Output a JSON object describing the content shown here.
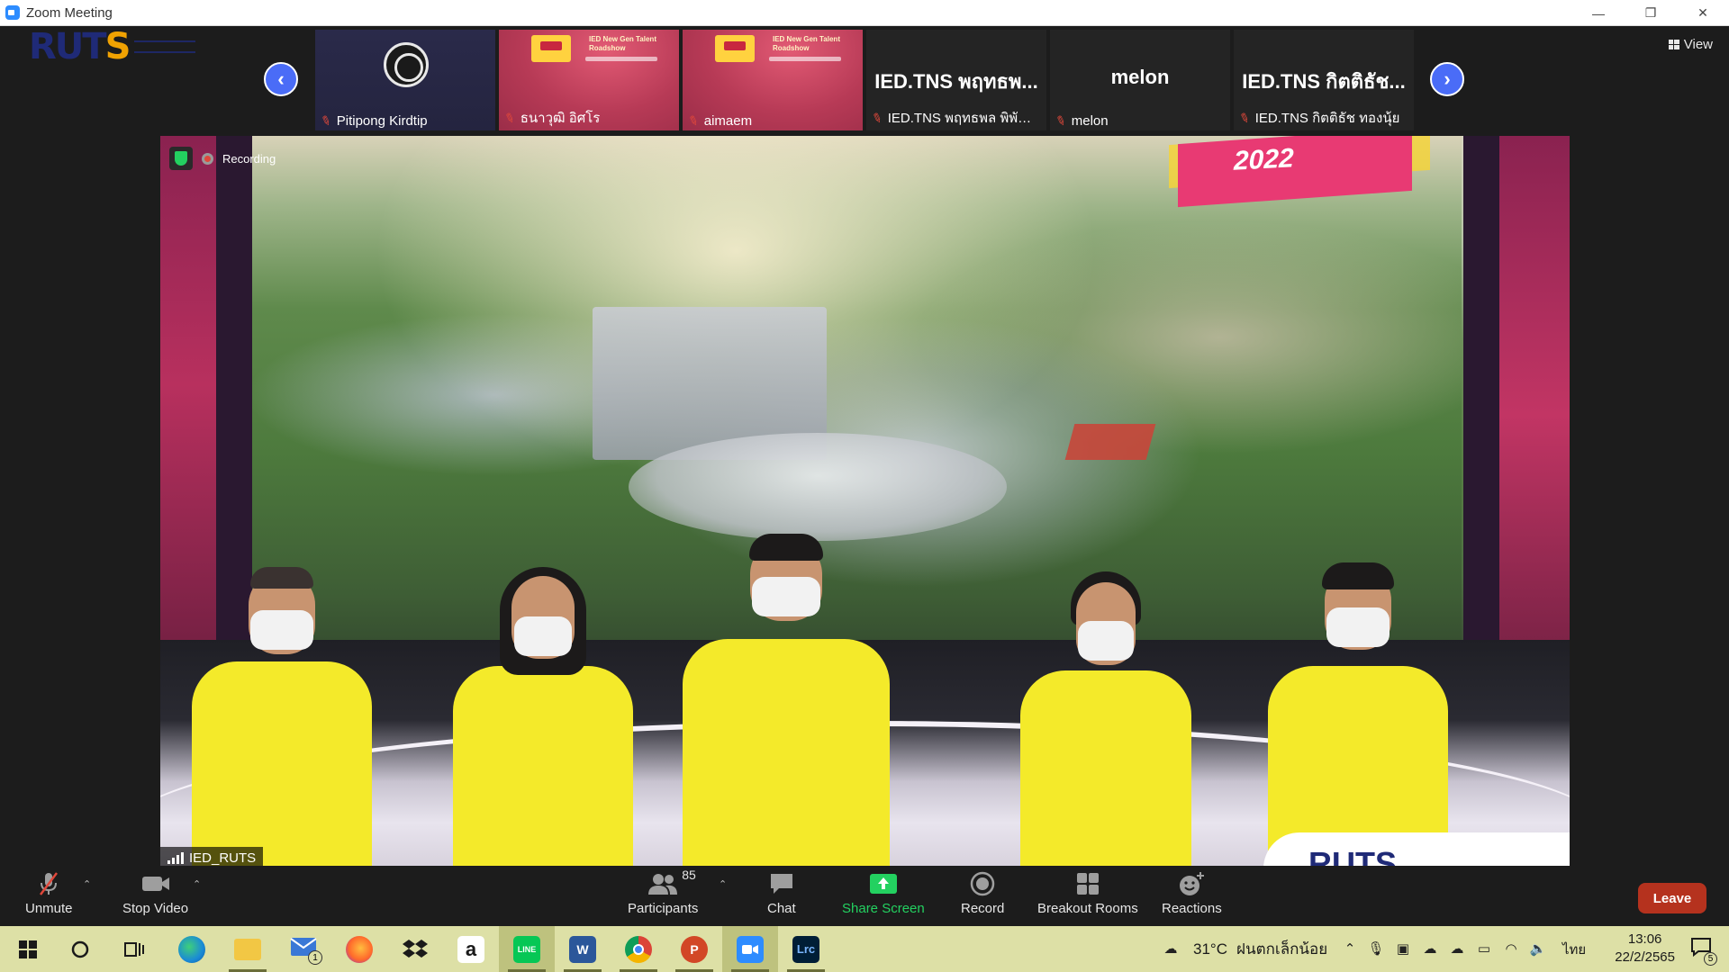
{
  "window": {
    "title": "Zoom Meeting",
    "minimize": "—",
    "restore": "❐",
    "close": "✕"
  },
  "gallery": {
    "logo_text": "RUT",
    "logo_accent": "S",
    "tiles": [
      {
        "kind": "obs",
        "label": "Pitipong Kirdtip"
      },
      {
        "kind": "poster",
        "label": "ธนาวุฒิ อิศโร",
        "poster_title": "IED New Gen Talent Roadshow"
      },
      {
        "kind": "poster",
        "label": "aimaem",
        "poster_title": "IED New Gen Talent Roadshow"
      },
      {
        "kind": "text",
        "big": "IED.TNS พฤทธพ...",
        "label": "IED.TNS พฤทธพล พิพัฒ..."
      },
      {
        "kind": "text",
        "big": "melon",
        "label": "melon"
      },
      {
        "kind": "text",
        "big": "IED.TNS กิตติธัช...",
        "label": "IED.TNS กิตติธัช ทองนุ้ย"
      }
    ],
    "view_label": "View"
  },
  "video": {
    "recording_label": "Recording",
    "banner_year": "2022",
    "speaker_name": "IED_RUTS",
    "backdrop_logo": "RUTS"
  },
  "toolbar": {
    "unmute": "Unmute",
    "stop_video": "Stop Video",
    "participants": "Participants",
    "participants_count": "85",
    "chat": "Chat",
    "share_screen": "Share Screen",
    "record": "Record",
    "breakout_rooms": "Breakout Rooms",
    "reactions": "Reactions",
    "leave": "Leave"
  },
  "taskbar": {
    "weather": "31°C",
    "weather_desc": "ฝนตกเล็กน้อย",
    "language": "ไทย",
    "time": "13:06",
    "date": "22/2/2565",
    "mail_badge": "1",
    "notification_count": "5",
    "apps": [
      "start",
      "search",
      "task-view",
      "edge",
      "file-explorer",
      "mail",
      "firefox",
      "dropbox",
      "amazon",
      "line",
      "word",
      "chrome",
      "powerpoint",
      "zoom",
      "lightroom"
    ]
  },
  "colors": {
    "zoom_blue": "#2d8cff",
    "share_green": "#23d160",
    "leave_red": "#b5321e",
    "nav_arrow": "#4a6cf7",
    "shirt_yellow": "#f4ea2a",
    "taskbar": "#dde0a6"
  }
}
